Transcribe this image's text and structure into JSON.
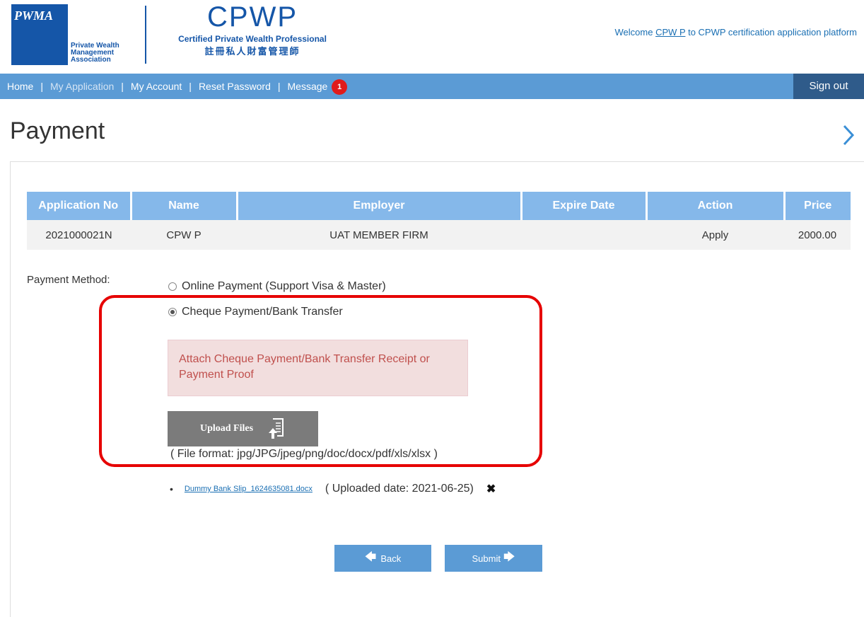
{
  "header": {
    "pwma_abbr": "PWMA",
    "pwma_name_1": "Private Wealth",
    "pwma_name_2": "Management",
    "pwma_name_3": "Association",
    "cpwp_logo_text": "CPWP",
    "cpwp_title": "Certified Private Wealth Professional",
    "cpwp_chinese": "註冊私人財富管理師",
    "welcome_prefix": "Welcome",
    "welcome_user": "CPW P",
    "welcome_suffix": "to CPWP certification application platform"
  },
  "nav": {
    "home": "Home",
    "my_application": "My Application",
    "my_account": "My Account",
    "reset_password": "Reset Password",
    "message": "Message",
    "message_count": "1",
    "separator": "|",
    "sign_out": "Sign out"
  },
  "page": {
    "title": "Payment"
  },
  "table": {
    "headers": [
      "Application No",
      "Name",
      "Employer",
      "Expire Date",
      "Action",
      "Price"
    ],
    "rows": [
      [
        "2021000021N",
        "CPW P",
        "UAT MEMBER FIRM",
        "",
        "Apply",
        "2000.00"
      ]
    ]
  },
  "payment": {
    "label": "Payment Method:",
    "options": [
      {
        "label": "Online Payment (Support Visa & Master)",
        "checked": false
      },
      {
        "label": "Cheque Payment/Bank Transfer",
        "checked": true
      }
    ],
    "alert_text": "Attach Cheque Payment/Bank Transfer Receipt or Payment Proof",
    "upload_label": "Upload Files",
    "file_format": "( File format: jpg/JPG/jpeg/png/doc/docx/pdf/xls/xlsx )",
    "uploaded_file": "Dummy Bank Slip_1624635081.docx",
    "uploaded_date": "( Uploaded date: 2021-06-25)"
  },
  "buttons": {
    "back": "Back",
    "submit": "Submit"
  },
  "colors": {
    "nav": "#5b9bd5",
    "signout": "#2f5b8a",
    "table_header": "#85b8ea",
    "highlight": "#e60000",
    "alert_bg": "#f2dede"
  }
}
